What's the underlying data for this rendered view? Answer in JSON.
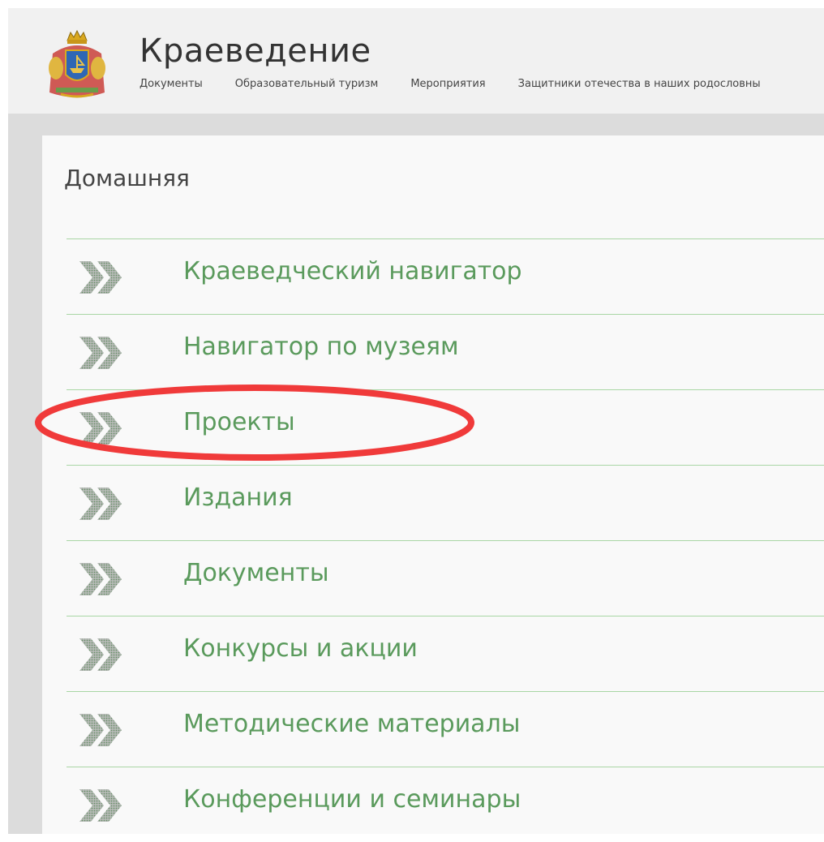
{
  "header": {
    "site_title": "Краеведение",
    "nav": [
      {
        "label": "Документы"
      },
      {
        "label": "Образовательный туризм"
      },
      {
        "label": "Мероприятия"
      },
      {
        "label": "Защитники отечества в наших родословны"
      }
    ]
  },
  "main": {
    "page_title": "Домашняя",
    "menu": [
      {
        "label": "Краеведческий навигатор"
      },
      {
        "label": "Навигатор по музеям"
      },
      {
        "label": "Проекты"
      },
      {
        "label": "Издания"
      },
      {
        "label": "Документы"
      },
      {
        "label": "Конкурсы и акции"
      },
      {
        "label": "Методические материалы"
      },
      {
        "label": "Конференции и семинары"
      }
    ]
  },
  "colors": {
    "accent_green": "#5a9a5c",
    "divider_green": "#a9d6a5",
    "highlight_red": "#f03a3a"
  },
  "icons": {
    "menu_icon": "double-chevron-icon",
    "logo": "coat-of-arms-logo"
  }
}
